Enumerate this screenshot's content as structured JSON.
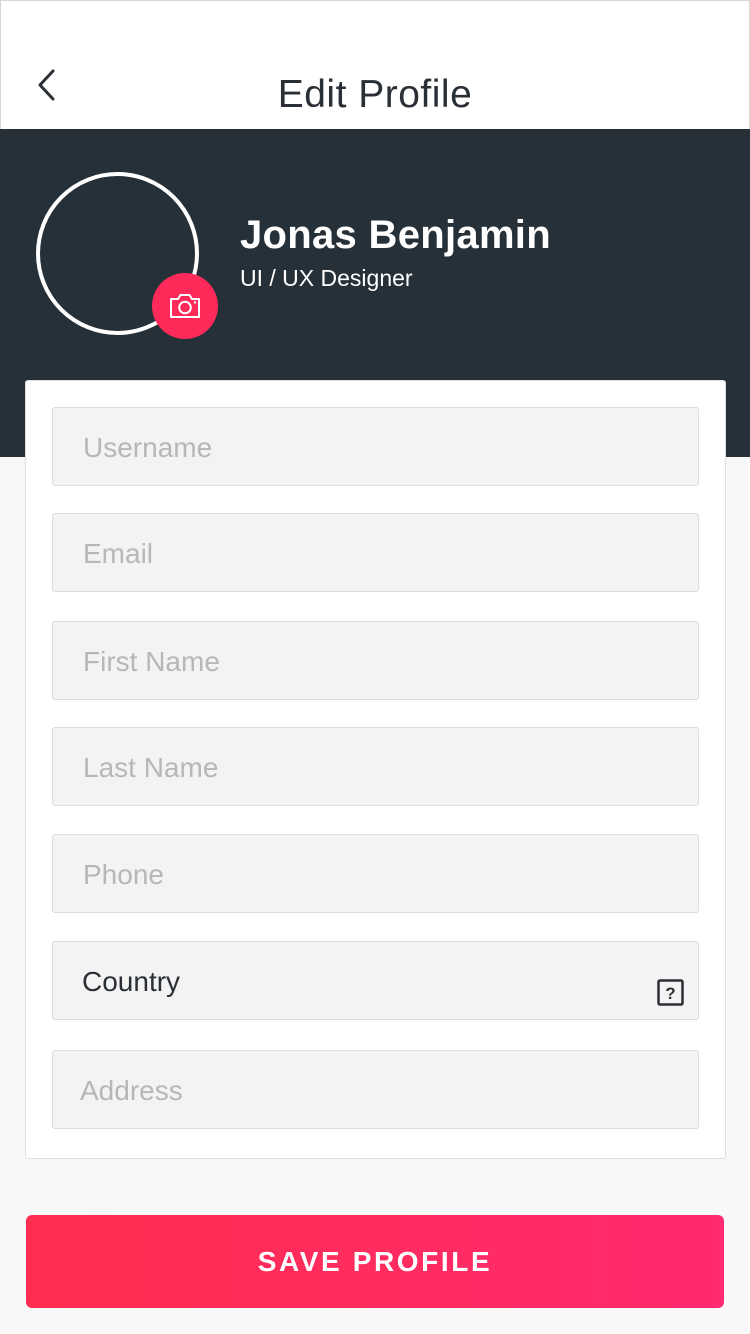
{
  "header": {
    "title": "Edit Profile",
    "back_icon": "chevron-left-icon"
  },
  "profile": {
    "name": "Jonas Benjamin",
    "role": "UI / UX Designer",
    "camera_icon": "camera-icon"
  },
  "form": {
    "fields": [
      {
        "label": "Username",
        "state": "placeholder"
      },
      {
        "label": "Email",
        "state": "placeholder"
      },
      {
        "label": "First Name",
        "state": "placeholder"
      },
      {
        "label": "Last Name",
        "state": "placeholder"
      },
      {
        "label": "Phone",
        "state": "placeholder"
      },
      {
        "label": "Country",
        "state": "filled",
        "icon": "help-icon"
      },
      {
        "label": "Address",
        "state": "placeholder"
      }
    ]
  },
  "actions": {
    "save_label": "SAVE PROFILE"
  },
  "colors": {
    "accent": "#ff2a5a",
    "hero_bg": "#263039",
    "field_bg": "#f3f3f3",
    "placeholder": "#b7b7b7",
    "text_dark": "#2a2f36"
  }
}
